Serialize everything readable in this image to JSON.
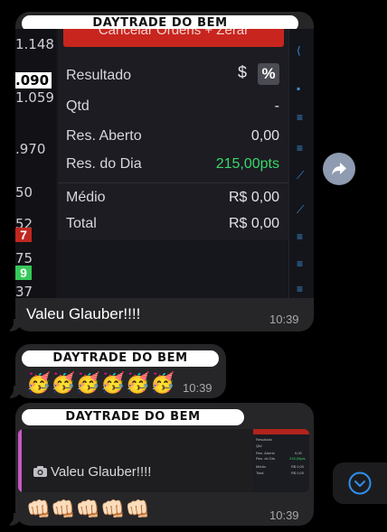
{
  "messages": [
    {
      "sender": "DAYTRADE DO BEM",
      "text": "Valeu Glauber!!!!",
      "time": "10:39",
      "screenshot": {
        "top_button": "Cancelar Ordens + Zerar",
        "prices": [
          "1.148",
          ".090",
          "1.059",
          ".970",
          "50",
          "52",
          "75",
          "37"
        ],
        "badges": [
          "7",
          "9"
        ],
        "currency_symbol": "$",
        "percent_symbol": "%",
        "rows": [
          {
            "label": "Resultado",
            "value": ""
          },
          {
            "label": "Qtd",
            "value": "-"
          },
          {
            "label": "Res. Aberto",
            "value": "0,00"
          },
          {
            "label": "Res. do Dia",
            "value": "215,00pts"
          },
          {
            "label": "Médio",
            "value": "R$ 0,00"
          },
          {
            "label": "Total",
            "value": "R$ 0,00"
          }
        ]
      }
    },
    {
      "sender": "DAYTRADE DO BEM",
      "emojis": "🥳🥳🥳🥳🥳🥳",
      "time": "10:39"
    },
    {
      "sender": "DAYTRADE DO BEM",
      "reply_text": "Valeu Glauber!!!!",
      "reply_icon": "camera-icon",
      "reply_thumb": {
        "rows": [
          {
            "label": "Resultado",
            "value": ""
          },
          {
            "label": "Qtd",
            "value": ""
          },
          {
            "label": "Res. Aberto",
            "value": "0,00"
          },
          {
            "label": "Res. do Dia",
            "value": "215,00pts"
          },
          {
            "label": "Médio",
            "value": "R$ 0,00"
          },
          {
            "label": "Total",
            "value": "R$ 0,00"
          }
        ]
      },
      "emojis": "👊🏻👊🏻👊🏻👊🏻👊🏻",
      "time": "10:39"
    }
  ],
  "colors": {
    "background": "#000000",
    "bubble": "#262628",
    "reply_bar": "#c957c5",
    "green_value": "#39d66a",
    "cancel_button": "#c8251e"
  },
  "icons": {
    "forward": "forward-arrow-icon",
    "scroll_down": "chevron-down-circle-icon"
  }
}
